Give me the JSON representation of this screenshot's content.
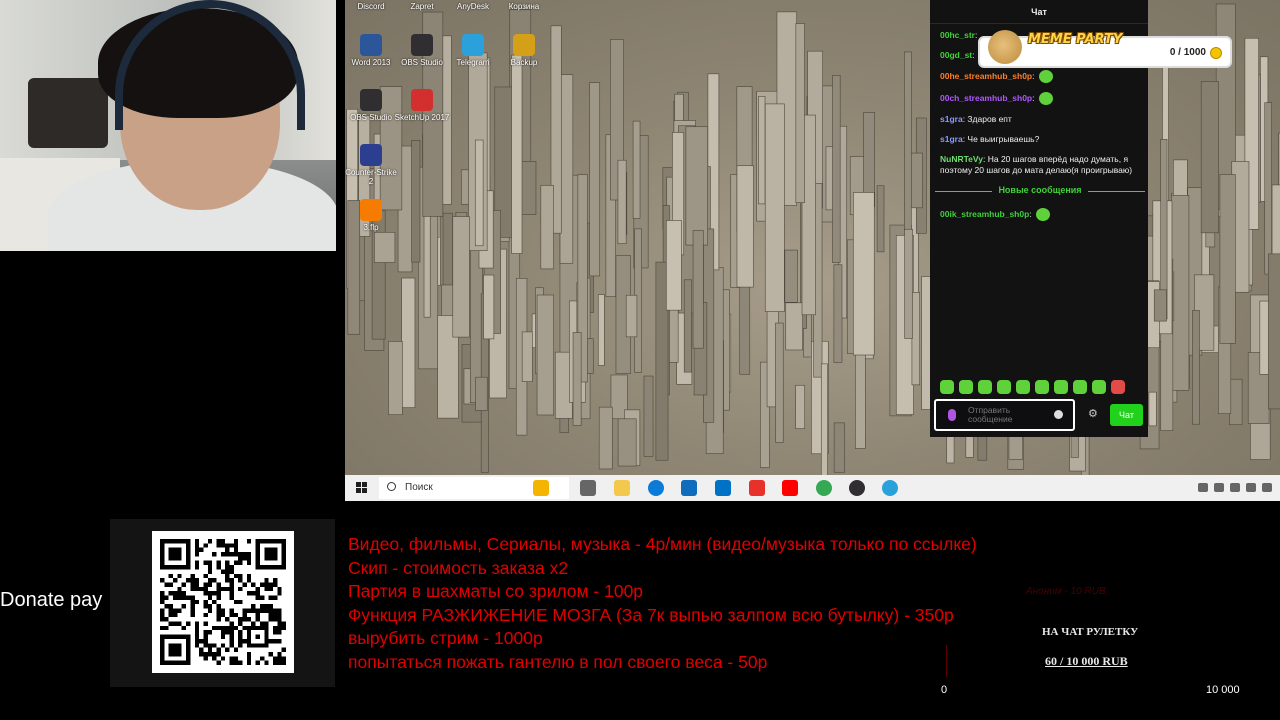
{
  "desktop": {
    "icons": [
      {
        "label": "Discord",
        "name": "discord-icon",
        "color": "#5865f2"
      },
      {
        "label": "Zapret",
        "name": "zapret-icon",
        "color": "#888888"
      },
      {
        "label": "AnyDesk",
        "name": "anydesk-icon",
        "color": "#ef443b"
      },
      {
        "label": "Корзина",
        "name": "recycle-bin-icon",
        "color": "#9aa7b8"
      },
      {
        "label": "Word 2013",
        "name": "word-icon",
        "color": "#2b579a"
      },
      {
        "label": "OBS Studio",
        "name": "obs-icon",
        "color": "#302e31"
      },
      {
        "label": "Telegram",
        "name": "telegram-icon",
        "color": "#2aa1da"
      },
      {
        "label": "Backup",
        "name": "backup-icon",
        "color": "#d4a017"
      },
      {
        "label": "OBS Studio",
        "name": "obs-icon",
        "color": "#302e31"
      },
      {
        "label": "SketchUp 2017",
        "name": "sketchup-icon",
        "color": "#d32f2f"
      },
      {
        "label": "Counter-Strike 2",
        "name": "cs2-icon",
        "color": "#2c3e90"
      },
      {
        "label": "3.flp",
        "name": "flstudio-icon",
        "color": "#f57c00"
      }
    ]
  },
  "chat": {
    "header": "Чат",
    "messages": [
      {
        "user": "00hc_str",
        "text": "",
        "color": "#3fd13a",
        "emote": false
      },
      {
        "user": "00gd_st",
        "text": "",
        "color": "#3fd13a",
        "emote": false
      },
      {
        "user": "00he_streamhub_sh0p",
        "text": "",
        "color": "#ff7f24",
        "emote": true
      },
      {
        "user": "00ch_streamhub_sh0p",
        "text": "",
        "color": "#b057ff",
        "emote": true
      },
      {
        "user": "s1gra",
        "text": "Здаров епт",
        "color": "#8a9bff",
        "emote": false
      },
      {
        "user": "s1gra",
        "text": "Че выигрываешь?",
        "color": "#8a9bff",
        "emote": false
      },
      {
        "user": "NuNRTeVy",
        "text": "На 20 шагов вперёд надо думать, я поэтому 20 шагов до мата делаю(я проигрываю)",
        "color": "#6fdc6f",
        "emote": false
      }
    ],
    "divider": "Новые сообщения",
    "new_messages": [
      {
        "user": "00ik_streamhub_sh0p",
        "text": "",
        "color": "#3fd13a",
        "emote": true
      }
    ],
    "input_placeholder": "Отправить сообщение",
    "send_label": "Чат"
  },
  "meme_party": {
    "title": "MEME PARTY",
    "progress": "0 / 1000"
  },
  "taskbar": {
    "search_label": "Поиск",
    "apps": [
      {
        "name": "copilot-icon",
        "color": "#f5b400"
      },
      {
        "name": "task-view-icon",
        "color": "#666666"
      },
      {
        "name": "file-explorer-icon",
        "color": "#f2c94c"
      },
      {
        "name": "edge-icon",
        "color": "#0c7bd8"
      },
      {
        "name": "store-icon",
        "color": "#0f6cbd"
      },
      {
        "name": "outlook-icon",
        "color": "#0072c6"
      },
      {
        "name": "yandex-browser-icon",
        "color": "#e8312a"
      },
      {
        "name": "yandex-icon",
        "color": "#ff0000"
      },
      {
        "name": "chrome-icon",
        "color": "#34a853"
      },
      {
        "name": "obs-icon",
        "color": "#302e31"
      },
      {
        "name": "telegram-icon",
        "color": "#2aa1da"
      }
    ]
  },
  "donate": {
    "label": "Donate pay",
    "price_list": [
      "Видео, фильмы, Сериалы, музыка - 4р/мин (видео/музыка только по ссылке)",
      "Скип - стоимость заказа x2",
      "Партия в шахматы со зрилом - 100р",
      "Функция РАЗЖИЖЕНИЕ МОЗГА (За 7к выпью залпом всю бутылку) - 350р",
      "вырубить стрим - 1000р",
      "попытаться пожать гантелю в пол своего веса - 50р"
    ],
    "faint_amount": "Аноним - 10 RUB"
  },
  "goal": {
    "title": "НА ЧАТ РУЛЕТКУ",
    "progress_text": "60 / 10 000 RUB",
    "min": "0",
    "max": "10 000"
  }
}
